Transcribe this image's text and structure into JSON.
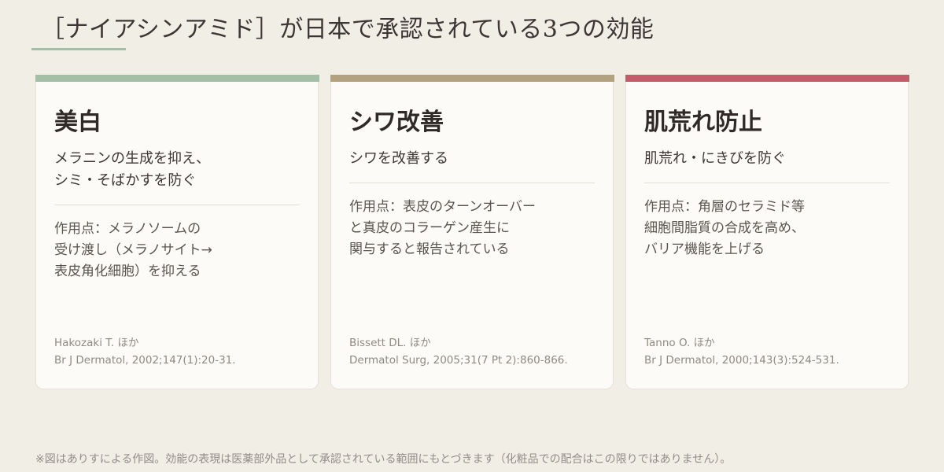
{
  "page": {
    "title": "［ナイアシンアミド］が日本で承認されている3つの効能",
    "footnote": "※図はありすによる作図。効能の表現は医薬部外品として承認されている範囲にもとづきます（化粧品での配合はこの限りではありません）。"
  },
  "colors": {
    "card1_accent": "#a3bfa6",
    "card2_accent": "#b3a27f",
    "card3_accent": "#c45b68"
  },
  "cards": [
    {
      "heading": "美白",
      "sub": "メラニンの生成を抑え、\nシミ・そばかすを防ぐ",
      "desc": "作用点：メラノソームの\n受け渡し（メラノサイト→\n表皮角化細胞）を抑える",
      "ref_author": "Hakozaki T. ほか",
      "ref_source": "Br J Dermatol, 2002;147(1):20-31."
    },
    {
      "heading": "シワ改善",
      "sub": "シワを改善する",
      "desc": "作用点：表皮のターンオーバー\nと真皮のコラーゲン産生に\n関与すると報告されている",
      "ref_author": "Bissett DL. ほか",
      "ref_source": "Dermatol Surg, 2005;31(7 Pt 2):860-866."
    },
    {
      "heading": "肌荒れ防止",
      "sub": "肌荒れ・にきびを防ぐ",
      "desc": "作用点：角層のセラミド等\n細胞間脂質の合成を高め、\nバリア機能を上げる",
      "ref_author": "Tanno O. ほか",
      "ref_source": "Br J Dermatol, 2000;143(3):524-531."
    }
  ]
}
